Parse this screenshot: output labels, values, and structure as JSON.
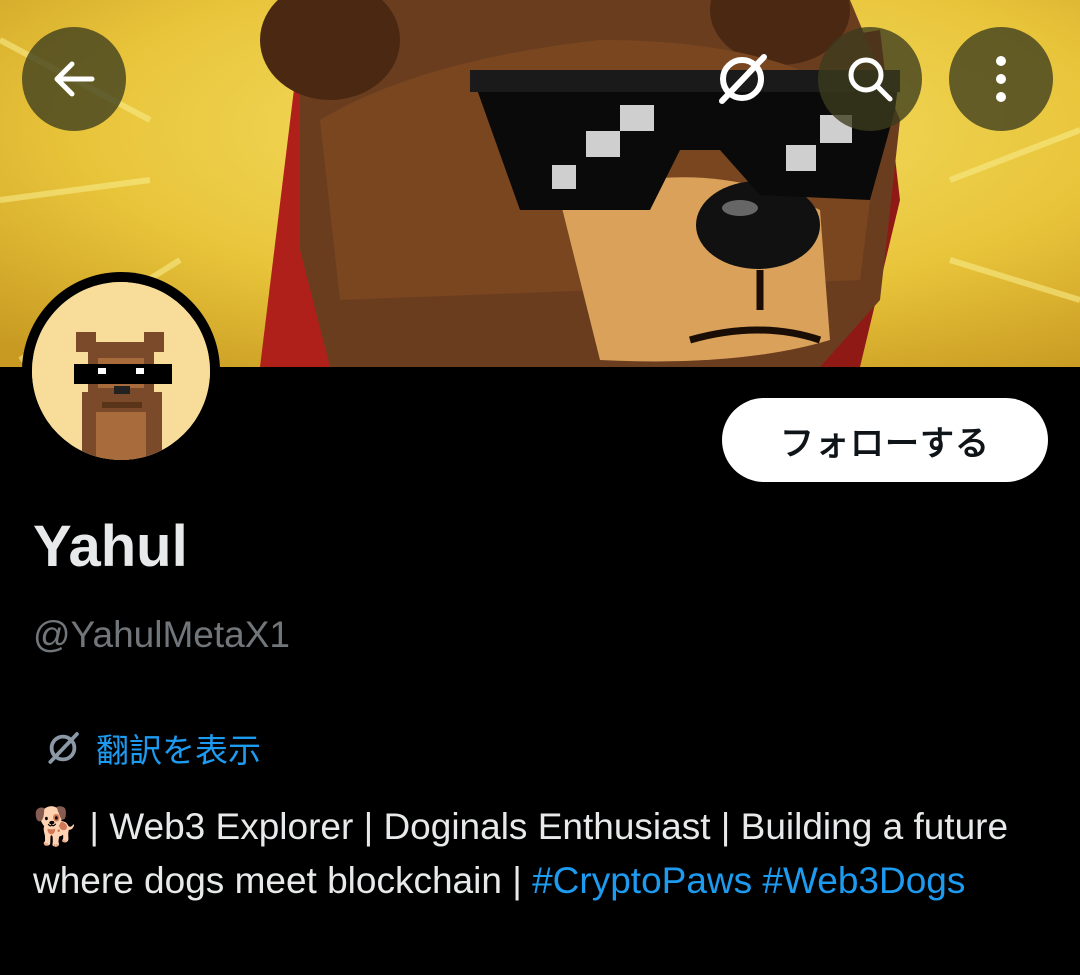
{
  "profile": {
    "name": "Yahul",
    "handle": "@YahulMetaX1",
    "follow_label": "フォローする",
    "translate_label": "翻訳を表示",
    "bio": {
      "emoji": "🐕",
      "text": " | Web3 Explorer | Doginals Enthusiast | Building a future where dogs meet blockchain | ",
      "hashtags": [
        "#CryptoPaws",
        "#Web3Dogs"
      ]
    }
  },
  "header": {
    "icons": [
      "back-arrow-icon",
      "grok-icon",
      "search-icon",
      "more-vertical-icon"
    ]
  },
  "colors": {
    "background": "#000000",
    "link": "#1d9bf0",
    "muted": "#71767b",
    "banner_yellow": "#e9c83a"
  }
}
